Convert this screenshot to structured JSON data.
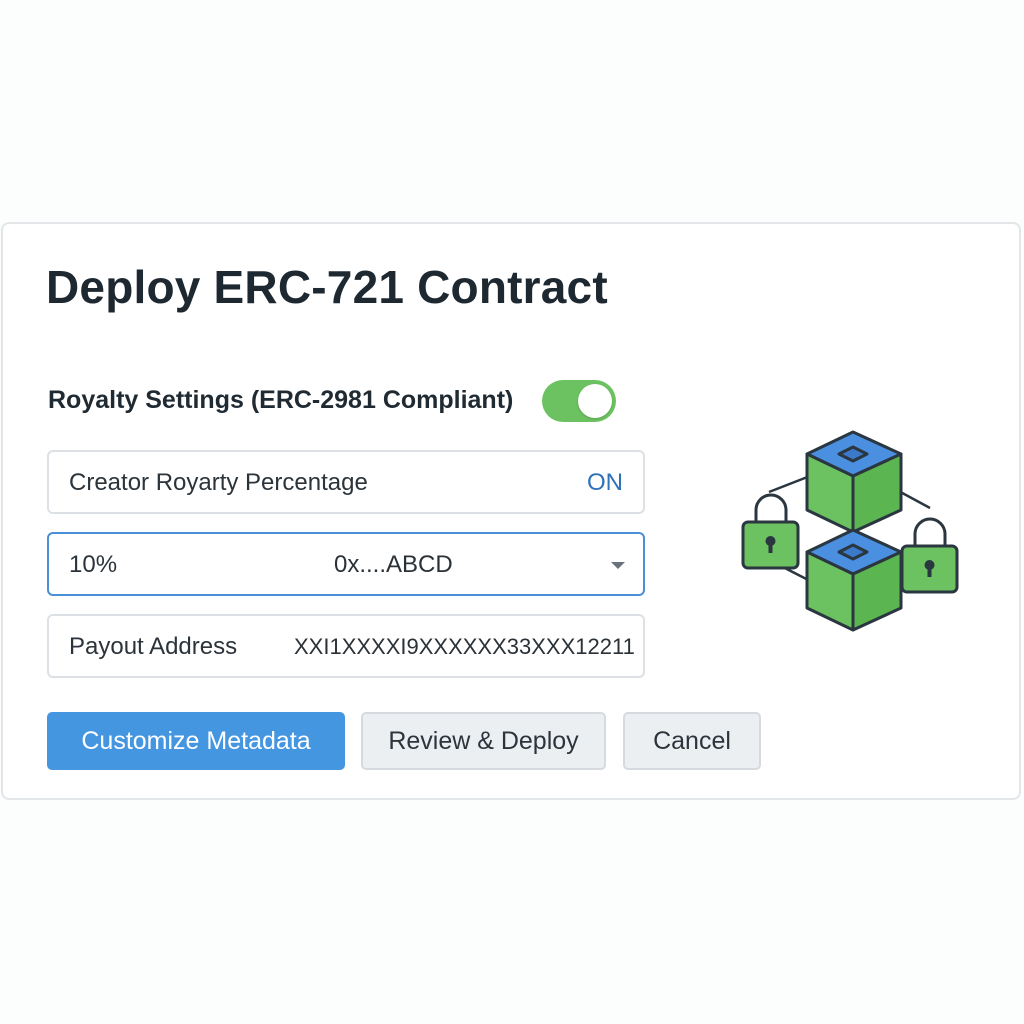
{
  "dialog": {
    "title": "Deploy ERC-721 Contract"
  },
  "royalty": {
    "section_label": "Royalty Settings (ERC-2981 Compliant)",
    "toggle_on": true,
    "toggle_color": "#6cc261"
  },
  "fields": {
    "creator_label": "Creator Royarty Percentage",
    "creator_state": "ON",
    "percentage_value": "10%",
    "address_short": "0x....ABCD",
    "payout_label": "Payout Address",
    "payout_value": "XXI1XXXXI9XXXXXX33XXX12211"
  },
  "buttons": {
    "customize": "Customize Metadata",
    "review": "Review & Deploy",
    "cancel": "Cancel"
  },
  "colors": {
    "primary": "#4596e0",
    "cube_top": "#4a8fe0",
    "cube_side": "#6cc261",
    "lock": "#6cc261",
    "outline": "#2a3640"
  },
  "icons": [
    "blockchain-cube-icon",
    "padlock-icon",
    "chevron-down-icon"
  ]
}
